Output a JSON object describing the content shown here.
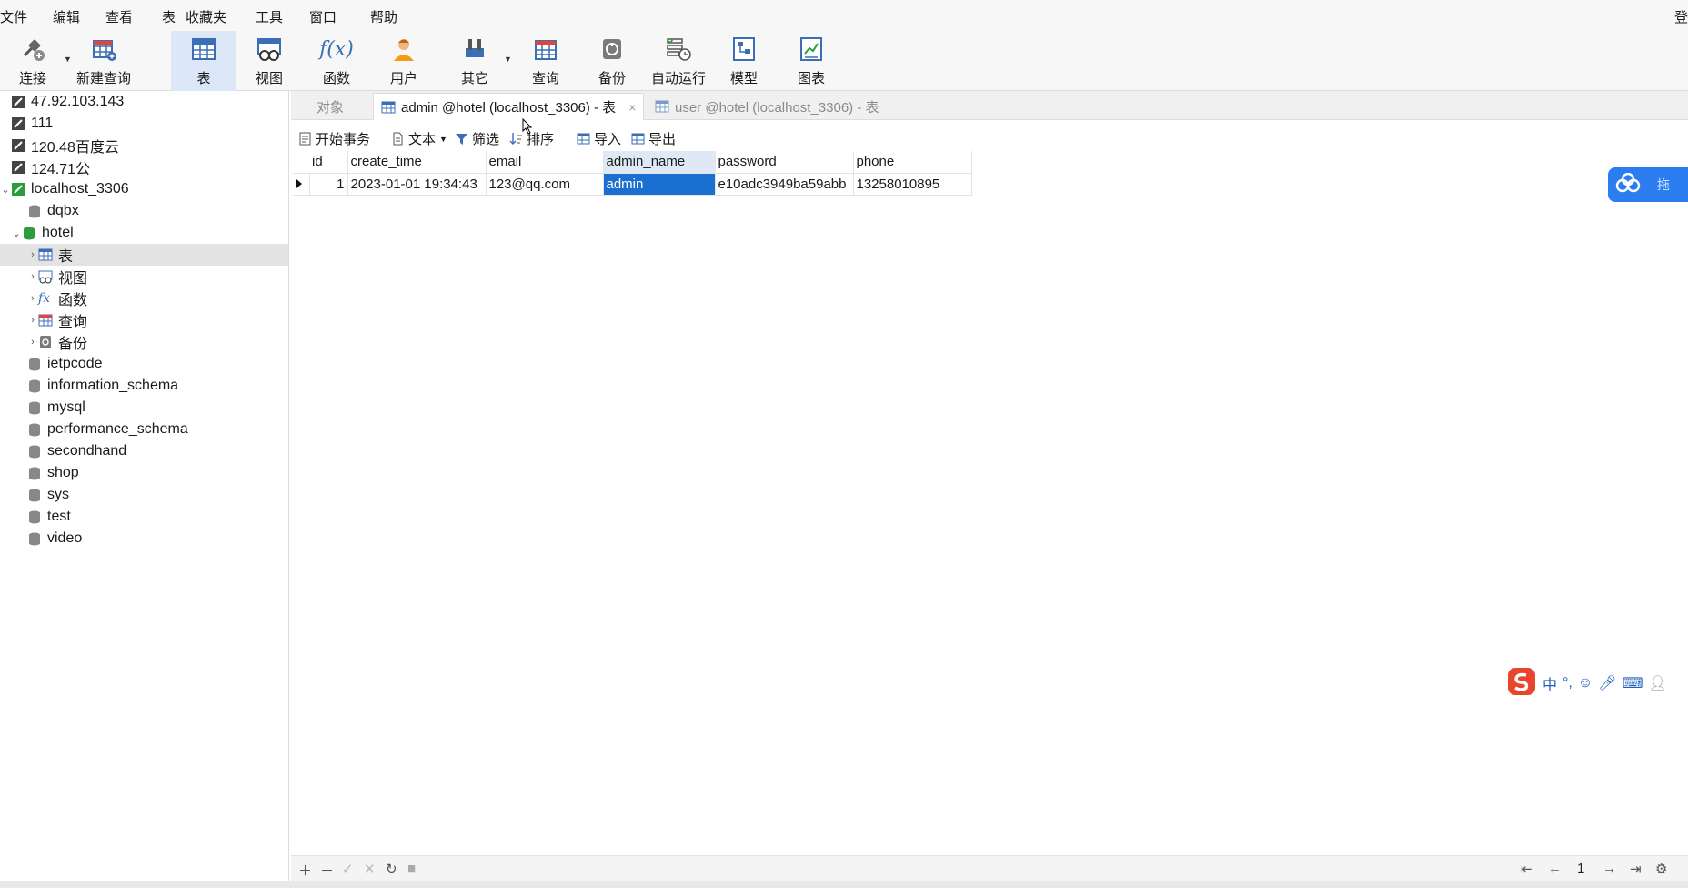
{
  "menu": [
    "文件",
    "编辑",
    "查看",
    "表",
    "收藏夹",
    "工具",
    "窗口",
    "帮助"
  ],
  "menu_login": "登",
  "toolbar": {
    "connect": "连接",
    "new_query": "新建查询",
    "table": "表",
    "view": "视图",
    "function": "函数",
    "user": "用户",
    "other": "其它",
    "query": "查询",
    "backup": "备份",
    "auto_run": "自动运行",
    "model": "模型",
    "chart": "图表"
  },
  "tree": {
    "connections": [
      "47.92.103.143",
      "111",
      "120.48百度云",
      "124.71公"
    ],
    "localhost": "localhost_3306",
    "db_dqbx": "dqbx",
    "db_hotel": "hotel",
    "hotel_children": [
      "表",
      "视图",
      "函数",
      "查询",
      "备份"
    ],
    "databases": [
      "ietpcode",
      "information_schema",
      "mysql",
      "performance_schema",
      "secondhand",
      "shop",
      "sys",
      "test",
      "video"
    ]
  },
  "tabs": {
    "objects": "对象",
    "active": "admin @hotel (localhost_3306) - 表",
    "inactive": "user @hotel (localhost_3306) - 表",
    "close": "×"
  },
  "subbar": {
    "begin_tx": "开始事务",
    "text": "文本",
    "filter": "筛选",
    "sort": "排序",
    "import": "导入",
    "export": "导出"
  },
  "grid": {
    "columns": [
      "id",
      "create_time",
      "email",
      "admin_name",
      "password",
      "phone"
    ],
    "rows": [
      [
        "1",
        "2023-01-01 19:34:43",
        "123@qq.com",
        "admin",
        "e10adc3949ba59abb",
        "13258010895"
      ]
    ]
  },
  "baidu": {
    "label": "拖"
  },
  "ime": {
    "zh": "中"
  },
  "bottom": {
    "page": "1"
  }
}
